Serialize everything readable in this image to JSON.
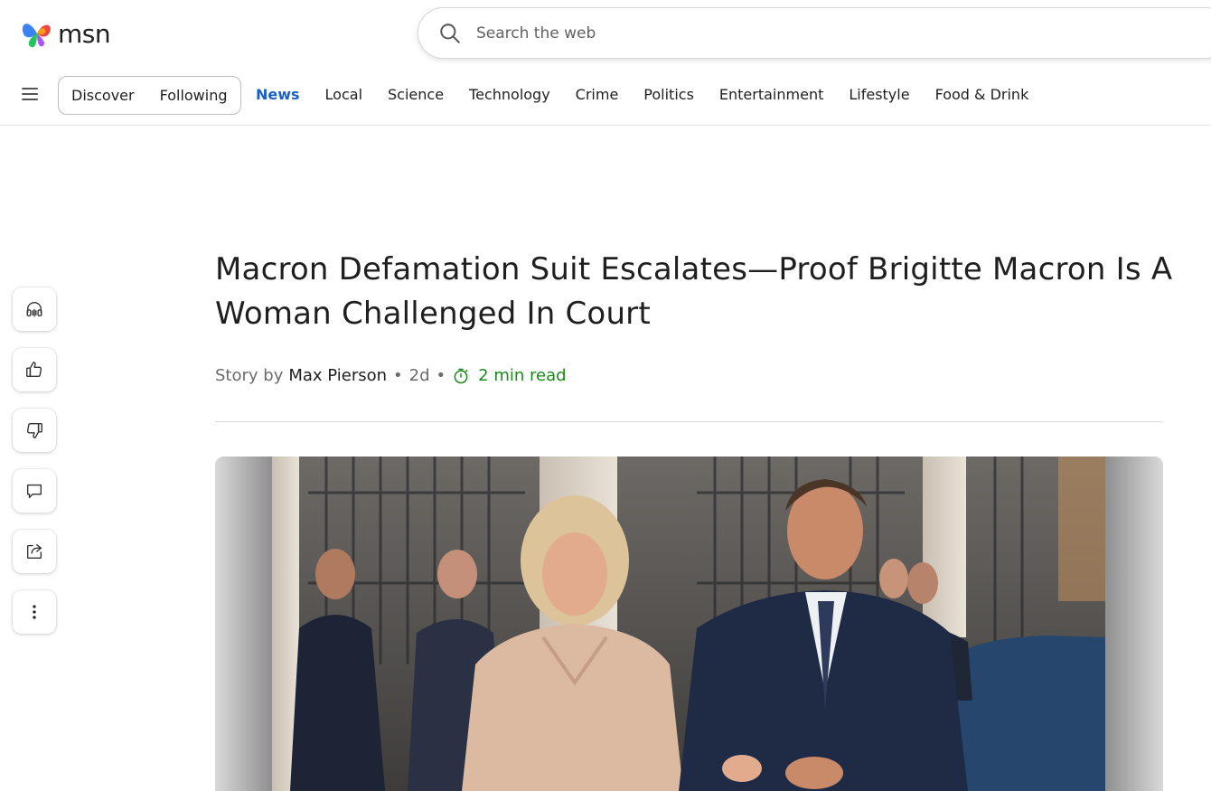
{
  "brand": {
    "logo_text": "msn"
  },
  "search": {
    "placeholder": "Search the web"
  },
  "nav": {
    "pill": [
      "Discover",
      "Following"
    ],
    "items": [
      "News",
      "Local",
      "Science",
      "Technology",
      "Crime",
      "Politics",
      "Entertainment",
      "Lifestyle",
      "Food & Drink"
    ],
    "active": "News"
  },
  "rail": {
    "buttons": [
      "headphones-icon",
      "thumbs-up-icon",
      "thumbs-down-icon",
      "comment-icon",
      "share-icon",
      "more-icon"
    ]
  },
  "article": {
    "title": "Macron Defamation Suit Escalates—Proof Brigitte Macron Is A Woman Challenged In Court",
    "byline_prefix": "Story by",
    "author": "Max Pierson",
    "age": "2d",
    "read_time": "2 min read"
  },
  "colors": {
    "accent": "#1a5fc8",
    "read_time": "#1a8a1a"
  }
}
